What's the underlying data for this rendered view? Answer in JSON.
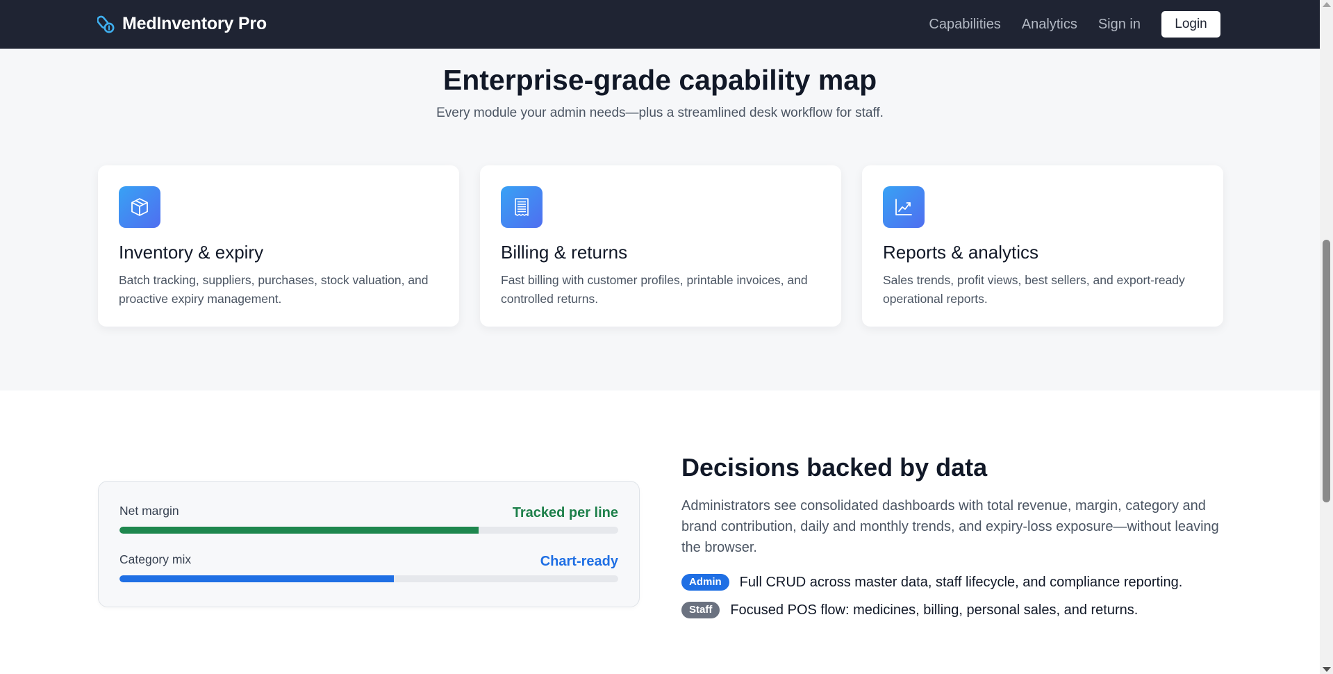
{
  "navbar": {
    "brand": "MedInventory Pro",
    "links": [
      "Capabilities",
      "Analytics",
      "Sign in"
    ],
    "login_label": "Login"
  },
  "capabilities": {
    "title": "Enterprise-grade capability map",
    "subtitle": "Every module your admin needs—plus a streamlined desk workflow for staff.",
    "cards": [
      {
        "icon": "box-icon",
        "title": "Inventory & expiry",
        "description": "Batch tracking, suppliers, purchases, stock valuation, and proactive expiry management."
      },
      {
        "icon": "receipt-icon",
        "title": "Billing & returns",
        "description": "Fast billing with customer profiles, printable invoices, and controlled returns."
      },
      {
        "icon": "chart-line-icon",
        "title": "Reports & analytics",
        "description": "Sales trends, profit views, best sellers, and export-ready operational reports."
      }
    ]
  },
  "analytics": {
    "metrics": [
      {
        "label": "Net margin",
        "value": "Tracked per line",
        "color": "#1e874e",
        "progress": 0.72
      },
      {
        "label": "Category mix",
        "value": "Chart-ready",
        "color": "#1f6fe4",
        "progress": 0.55
      }
    ],
    "title": "Decisions backed by data",
    "description": "Administrators see consolidated dashboards with total revenue, margin, category and brand contribution, daily and monthly trends, and expiry-loss exposure—without leaving the browser.",
    "roles": [
      {
        "badge": "Admin",
        "text": "Full CRUD across master data, staff lifecycle, and compliance reporting."
      },
      {
        "badge": "Staff",
        "text": "Focused POS flow: medicines, billing, personal sales, and returns."
      }
    ]
  },
  "colors": {
    "navbar_bg": "#1f2433",
    "accent_blue": "#1f6fe4",
    "accent_green": "#1e874e"
  }
}
